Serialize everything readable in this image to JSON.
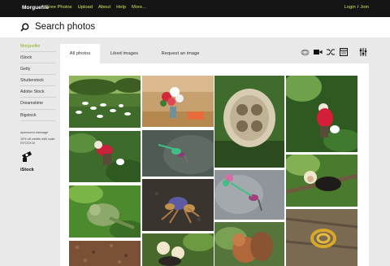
{
  "topbar": {
    "logo": "Morguefile",
    "nav": [
      "Free Photos",
      "Upload",
      "About",
      "Help",
      "More..."
    ],
    "login": "Login",
    "separator": "/",
    "join": "Join"
  },
  "search": {
    "title": "Search photos",
    "icon": "search-icon"
  },
  "sidebar": {
    "items": [
      "Morguefile",
      "iStock",
      "Getty",
      "Shutterstock",
      "Adobe Stock",
      "Dreamstime",
      "Bigstock"
    ],
    "active_index": 0,
    "sponsor_label": "sponsored message",
    "sponsor_text": "10% off credits with code: ISTOCK10",
    "sponsor_brand": "iStock"
  },
  "tabs": {
    "items": [
      "All photos",
      "Liked images",
      "Request an image"
    ],
    "active_index": 0
  },
  "tools": [
    "lightbox-icon",
    "video-icon",
    "shuffle-icon",
    "calendar-icon",
    "filter-sliders-icon"
  ],
  "colors": {
    "topbar_bg": "#141414",
    "nav_link": "#cfe65a",
    "active_sidebar": "#8ab31c",
    "content_bg": "#e9e9e9"
  },
  "photos": [
    "white-birds-on-lawn",
    "flower-bouquet-on-table",
    "bird-nest-with-eggs",
    "person-picking-in-field",
    "woman-tending-plants",
    "hummingbird-hovering",
    "capuchin-monkey-on-branch",
    "green-iguana-in-leaves",
    "purple-crab-on-sand",
    "hummingbird-at-flower",
    "snake-coiled-on-wood",
    "squirrel-eating",
    "monkeys-in-tree",
    "brown-gravel-texture"
  ]
}
